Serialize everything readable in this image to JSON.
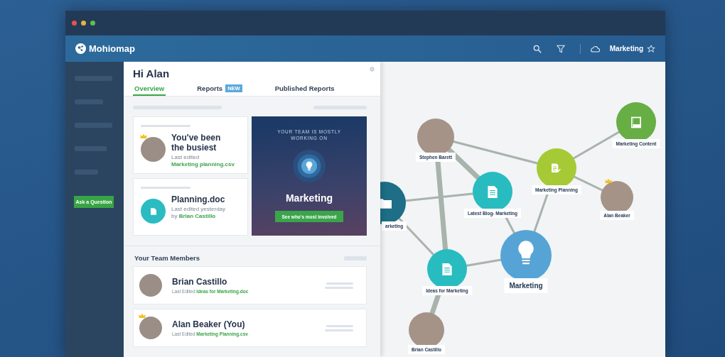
{
  "app": {
    "logo": "Mohiomap",
    "topic": "Marketing",
    "starred": false
  },
  "sidebar": {
    "button": "Ask a Question"
  },
  "panel": {
    "greeting": "Hi Alan",
    "tabs": [
      {
        "label": "Overview",
        "selected": true
      },
      {
        "label": "Reports",
        "selected": false,
        "badge": "NEW"
      },
      {
        "label": "Published Reports",
        "selected": false
      }
    ],
    "busiest_card": {
      "title": "You've been the busiest",
      "detail": "Last edited",
      "file": "Marketing planning.csv",
      "crowned": true
    },
    "document_card": {
      "title": "Planning.doc",
      "detail": "Last edited yesterday by",
      "person": "Brian Castillo"
    },
    "focus_card": {
      "caption": "YOUR TEAM IS MOSTLY WORKING ON",
      "topic": "Marketing",
      "button": "See who's most involved"
    },
    "team_heading": "Your Team Members",
    "members": [
      {
        "name": "Brian Castillo",
        "detail": "Last Edited",
        "file": "Ideas for Marketing.doc",
        "crowned": false
      },
      {
        "name": "Alan Beaker (You)",
        "detail": "Last Edited",
        "file": "Marketing Planning.csv",
        "crowned": true
      }
    ]
  },
  "map": {
    "nodes": [
      {
        "kind": "person",
        "label": "Stephen Barett",
        "crowned": false
      },
      {
        "kind": "folder",
        "label": "arketing",
        "color": "#1d6e86"
      },
      {
        "kind": "document",
        "label": "Latest Blog- Marketing",
        "color": "#28bcc0"
      },
      {
        "kind": "plan",
        "label": "Marketing Planning",
        "color": "#a5ca35"
      },
      {
        "kind": "book",
        "label": "Marketing Content",
        "color": "#67ae45"
      },
      {
        "kind": "person",
        "label": "Alan Beaker",
        "crowned": true
      },
      {
        "kind": "idea",
        "label": "Marketing",
        "color": "#56a4d6"
      },
      {
        "kind": "document",
        "label": "Ideas for Marketing",
        "color": "#28bcc0"
      },
      {
        "kind": "person",
        "label": "Brian Castillo",
        "crowned": false
      }
    ]
  }
}
